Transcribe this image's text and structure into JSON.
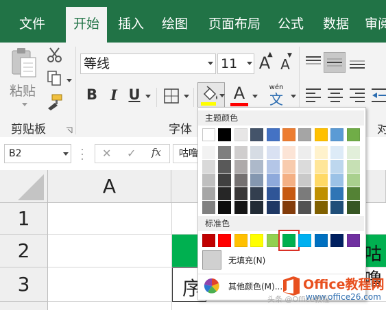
{
  "tabs": [
    "文件",
    "开始",
    "插入",
    "绘图",
    "页面布局",
    "公式",
    "数据",
    "审阅"
  ],
  "active_tab": "开始",
  "clipboard": {
    "paste_label": "粘贴",
    "group_label": "剪贴板"
  },
  "font": {
    "name": "等线",
    "size": "11",
    "group_label": "字体",
    "bold": "B",
    "italic": "I",
    "underline": "U",
    "grow": "A",
    "shrink": "A",
    "font_color_letter": "A",
    "wen_label": "wén",
    "wen_char": "文"
  },
  "align_group_partial": "对",
  "formula_bar": {
    "name_box": "B2",
    "cancel": "✕",
    "confirm": "✓",
    "fx": "fx",
    "content": "咕噜"
  },
  "grid": {
    "column_header": "A",
    "rows": [
      "1",
      "2",
      "3"
    ],
    "b3_partial": "序",
    "right_partial": "咕噜"
  },
  "colors": {
    "fill_underline": "#ffff00",
    "font_underline": "#ff0000",
    "green_header": "#00b050",
    "accent": "#217346"
  },
  "palette": {
    "theme_title": "主题颜色",
    "theme_colors": [
      "#ffffff",
      "#000000",
      "#e7e6e6",
      "#44546a",
      "#4472c4",
      "#ed7d31",
      "#a5a5a5",
      "#ffc000",
      "#5b9bd5",
      "#70ad47"
    ],
    "theme_tints": [
      [
        "#f2f2f2",
        "#7f7f7f",
        "#d0cece",
        "#d6dce4",
        "#d9e1f2",
        "#fce4d6",
        "#ededed",
        "#fff2cc",
        "#ddebf7",
        "#e2efda"
      ],
      [
        "#d9d9d9",
        "#595959",
        "#aeaaaa",
        "#adb9ca",
        "#b4c6e7",
        "#f8cbad",
        "#dbdbdb",
        "#ffe699",
        "#bdd7ee",
        "#c6e0b4"
      ],
      [
        "#bfbfbf",
        "#404040",
        "#757171",
        "#8497b0",
        "#8ea9db",
        "#f4b084",
        "#c9c9c9",
        "#ffd966",
        "#9bc2e6",
        "#a9d08e"
      ],
      [
        "#a6a6a6",
        "#262626",
        "#3a3838",
        "#333f4f",
        "#2f5597",
        "#c65911",
        "#7b7b7b",
        "#bf8f00",
        "#2f75b5",
        "#548235"
      ],
      [
        "#808080",
        "#0d0d0d",
        "#161616",
        "#222b35",
        "#1f3864",
        "#833c0b",
        "#525252",
        "#806000",
        "#1f4e78",
        "#375623"
      ]
    ],
    "standard_title": "标准色",
    "standard_colors": [
      "#c00000",
      "#ff0000",
      "#ffc000",
      "#ffff00",
      "#92d050",
      "#00b050",
      "#00b0f0",
      "#0070c0",
      "#002060",
      "#7030a0"
    ],
    "selected_standard_index": 5,
    "no_fill": "无填充(N)",
    "more_colors": "其他颜色(M)..."
  },
  "watermark": {
    "brand": "Office教程网",
    "url": "www.office26.com",
    "credit": "头条 @Office教程"
  }
}
